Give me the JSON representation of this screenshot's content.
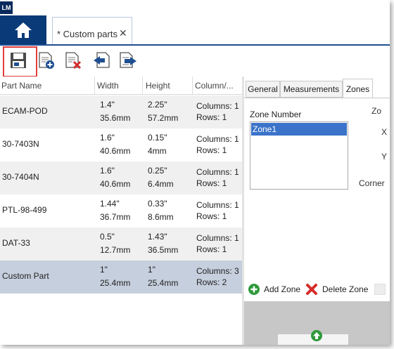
{
  "app": {
    "logo_text": "LM"
  },
  "tabs": {
    "home_icon": "home-icon",
    "document_tab_label": "* Custom parts",
    "document_tab_close": "✕"
  },
  "toolbar": {
    "buttons": [
      {
        "name": "save",
        "icon": "save-icon"
      },
      {
        "name": "add-part",
        "icon": "add-part-icon"
      },
      {
        "name": "delete-part",
        "icon": "delete-part-icon"
      },
      {
        "name": "import",
        "icon": "import-icon"
      },
      {
        "name": "export",
        "icon": "export-icon"
      }
    ]
  },
  "grid": {
    "columns": [
      "Part Name",
      "Width",
      "Height",
      "Column/..."
    ],
    "rows": [
      {
        "name": "ECAM-POD",
        "width_in": "1.4\"",
        "width_mm": "35.6mm",
        "height_in": "2.25\"",
        "height_mm": "57.2mm",
        "columns": "Columns: 1",
        "rows": "Rows: 1"
      },
      {
        "name": "30-7403N",
        "width_in": "1.6\"",
        "width_mm": "40.6mm",
        "height_in": "0.15\"",
        "height_mm": "4mm",
        "columns": "Columns: 1",
        "rows": "Rows: 1"
      },
      {
        "name": "30-7404N",
        "width_in": "1.6\"",
        "width_mm": "40.6mm",
        "height_in": "0.25\"",
        "height_mm": "6.4mm",
        "columns": "Columns: 1",
        "rows": "Rows: 1"
      },
      {
        "name": "PTL-98-499",
        "width_in": "1.44\"",
        "width_mm": "36.7mm",
        "height_in": "0.33\"",
        "height_mm": "8.6mm",
        "columns": "Columns: 1",
        "rows": "Rows: 1"
      },
      {
        "name": "DAT-33",
        "width_in": "0.5\"",
        "width_mm": "12.7mm",
        "height_in": "1.43\"",
        "height_mm": "36.5mm",
        "columns": "Columns: 1",
        "rows": "Rows: 1"
      },
      {
        "name": "Custom Part",
        "width_in": "1\"",
        "width_mm": "25.4mm",
        "height_in": "1\"",
        "height_mm": "25.4mm",
        "columns": "Columns: 3",
        "rows": "Rows: 2"
      }
    ]
  },
  "panel": {
    "tabs": [
      "General",
      "Measurements",
      "Zones"
    ],
    "active_tab": "Zones",
    "zone_number_label": "Zone Number",
    "zones": [
      "Zone1"
    ],
    "right_labels": [
      "Zo",
      "X",
      "Y",
      "Corner"
    ],
    "add_zone_label": "Add Zone",
    "delete_zone_label": "Delete Zone"
  },
  "colors": {
    "accent": "#0b3a78",
    "selection": "#c6cfdd",
    "highlight": "#e43c3c",
    "list_selection": "#3a73c9"
  }
}
